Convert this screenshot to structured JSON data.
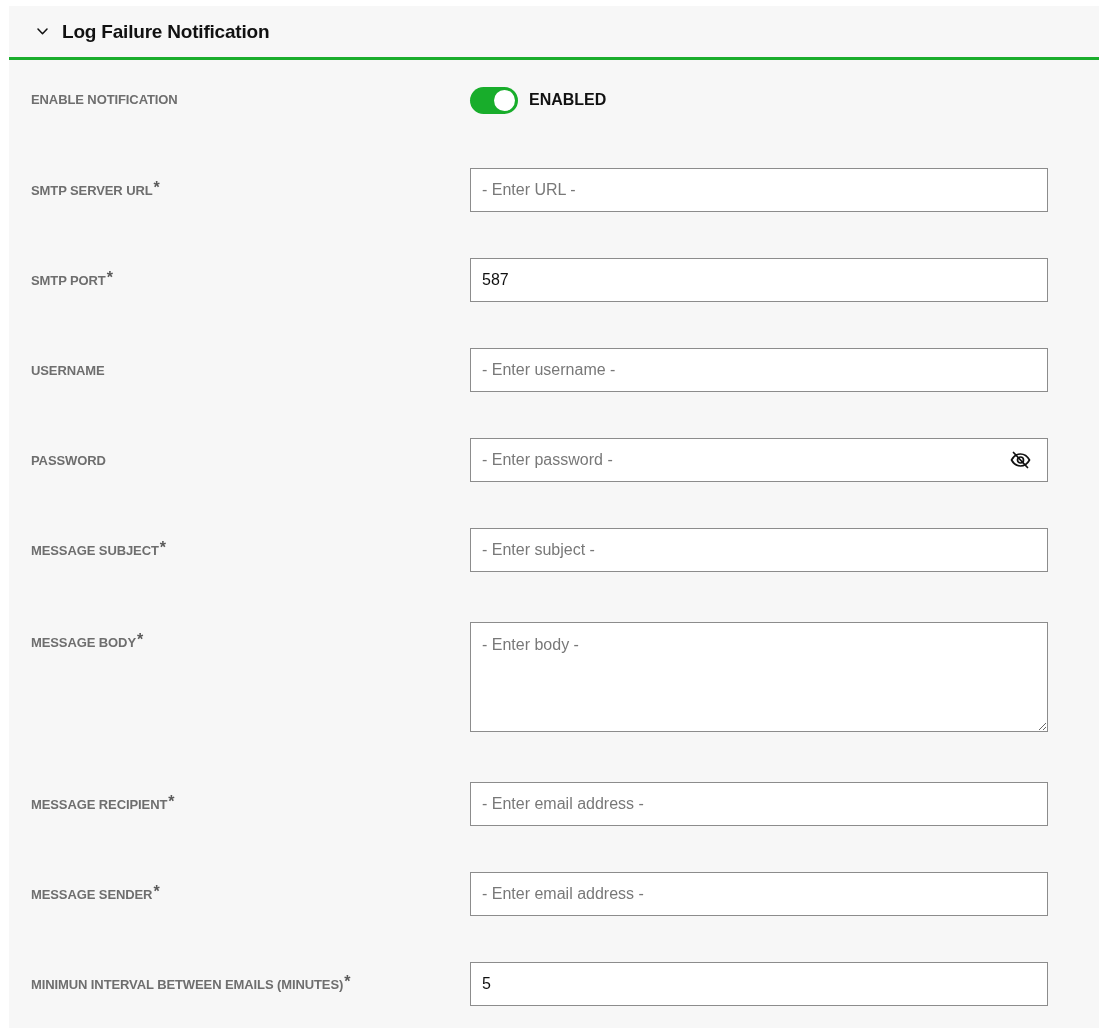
{
  "section": {
    "title": "Log Failure Notification",
    "expanded": true
  },
  "fields": [
    {
      "kind": "toggle",
      "label": "ENABLE NOTIFICATION",
      "on": true,
      "state_label": "ENABLED"
    },
    {
      "kind": "text",
      "label": "SMTP SERVER URL$^{*}$",
      "placeholder": "- Enter URL -"
    },
    {
      "kind": "text",
      "label": "SMTP PORT$^{*}$",
      "value": "587"
    },
    {
      "kind": "text",
      "label": "USERNAME",
      "placeholder": "- Enter username -"
    },
    {
      "kind": "password",
      "label": "PASSWORD",
      "placeholder": "- Enter password -"
    },
    {
      "kind": "text",
      "label": "MESSAGE SUBJECT$^{*}$",
      "placeholder": "- Enter subject -"
    },
    {
      "kind": "textarea",
      "label": "MESSAGE BODY$^{*}$",
      "placeholder": "- Enter body -"
    },
    {
      "kind": "text",
      "label": "MESSAGE RECIPIENT$^{*}$",
      "placeholder": "- Enter email address -"
    },
    {
      "kind": "text",
      "label": "MESSAGE SENDER$^{*}$",
      "placeholder": "- Enter email address -"
    },
    {
      "kind": "text",
      "label": "MINIMUN INTERVAL BETWEEN EMAILS (MINUTES)$^{*}$",
      "value": "5"
    }
  ]
}
